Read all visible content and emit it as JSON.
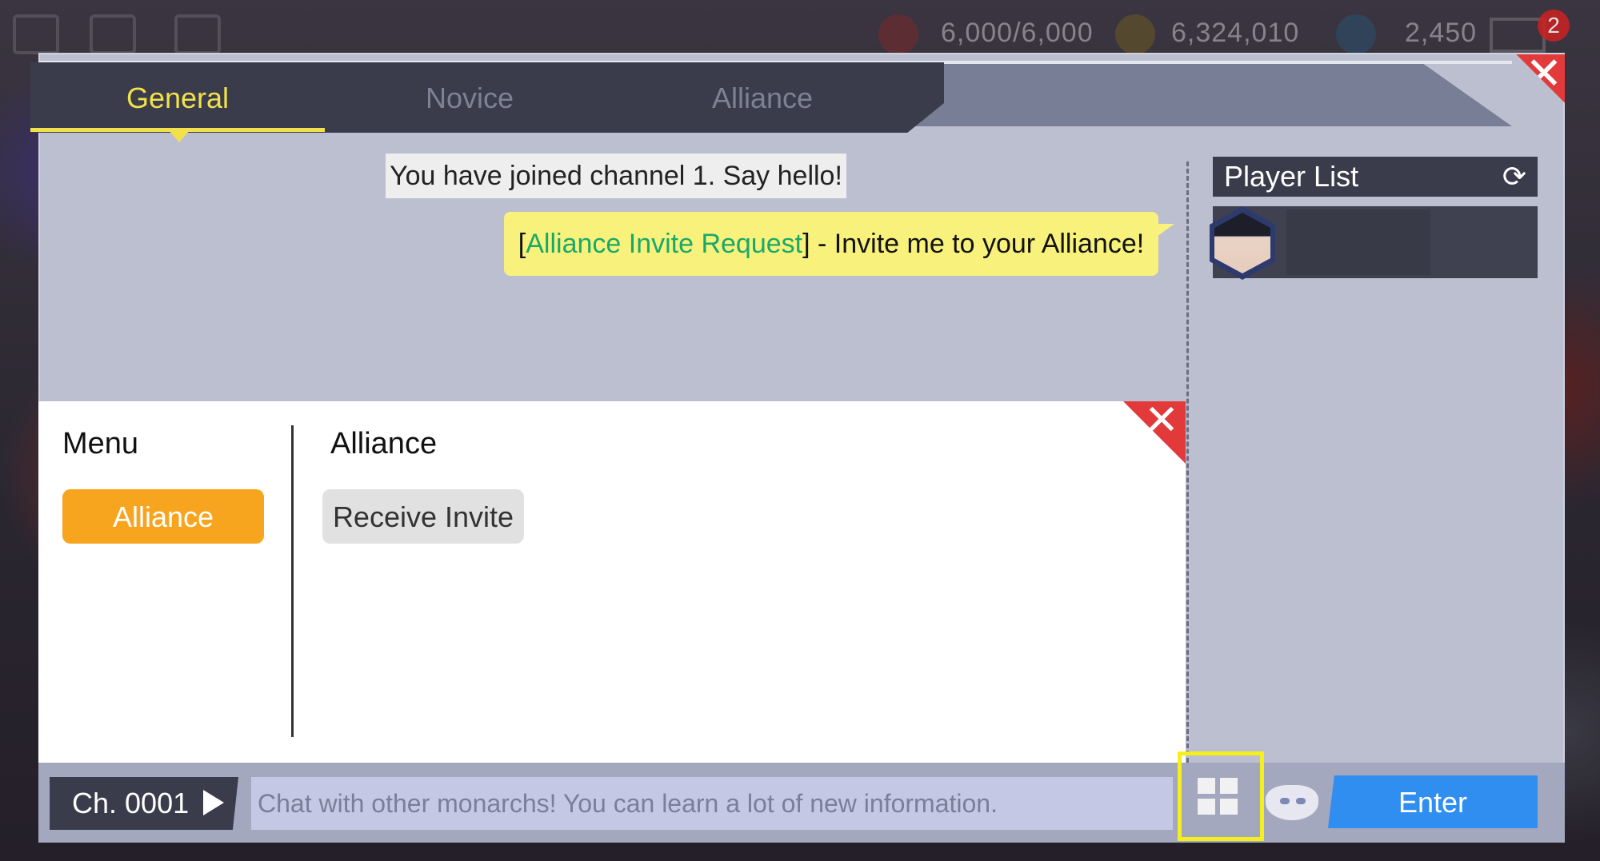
{
  "resources": {
    "stamina": "6,000/6,000",
    "gold": "6,324,010",
    "gems": "2,450",
    "mail_badge": "2"
  },
  "tabs": [
    {
      "label": "General",
      "active": true
    },
    {
      "label": "Novice",
      "active": false
    },
    {
      "label": "Alliance",
      "active": false
    }
  ],
  "chat": {
    "system_message": "You have joined channel 1. Say hello!",
    "invite_open": "[",
    "invite_link": "Alliance Invite Request",
    "invite_text": "] - Invite me to your Alliance!"
  },
  "player_list": {
    "title": "Player List"
  },
  "menu": {
    "title": "Menu",
    "item_alliance": "Alliance",
    "section_title": "Alliance",
    "receive_invite": "Receive Invite"
  },
  "bottom": {
    "channel": "Ch. 0001",
    "placeholder": "Chat with other monarchs! You can learn a lot of new information.",
    "enter": "Enter"
  },
  "colors": {
    "accent_yellow": "#f2e14a",
    "alliance_orange": "#f7a51e",
    "enter_blue": "#2f8ef0",
    "close_red": "#e23a3a",
    "highlight": "#f4ef1d"
  }
}
